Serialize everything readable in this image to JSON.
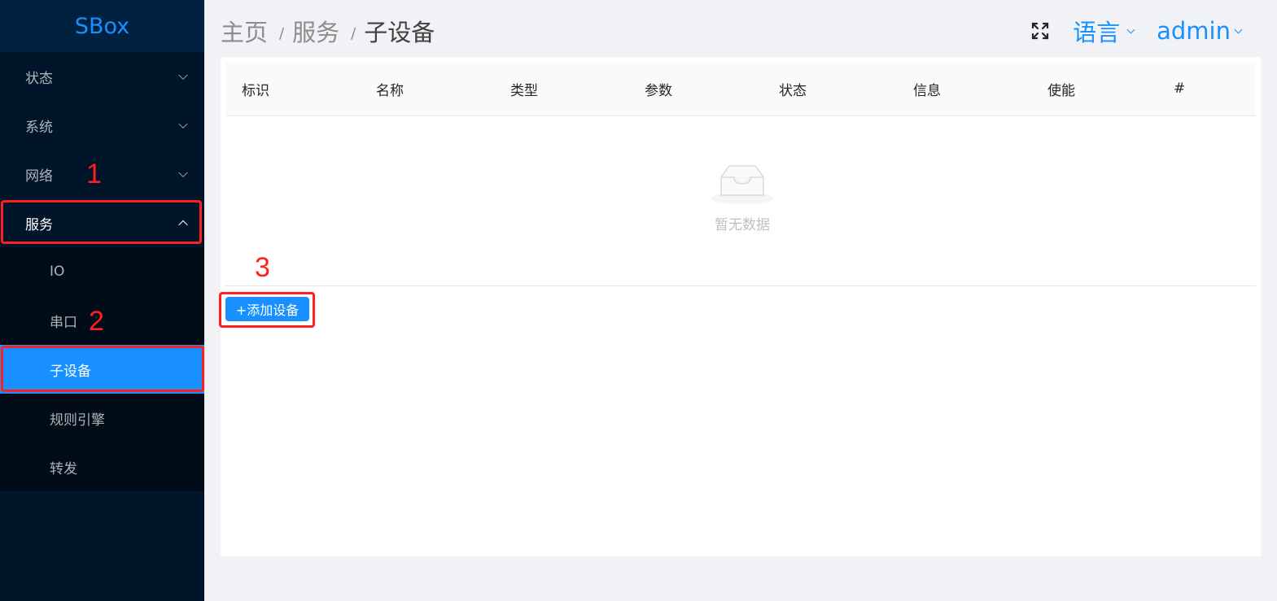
{
  "sidebar": {
    "logo": "SBox",
    "menu": [
      {
        "label": "状态"
      },
      {
        "label": "系统"
      },
      {
        "label": "网络"
      },
      {
        "label": "服务"
      }
    ],
    "submenu": [
      {
        "label": "IO"
      },
      {
        "label": "串口"
      },
      {
        "label": "子设备",
        "active": true
      },
      {
        "label": "规则引擎"
      },
      {
        "label": "转发"
      }
    ]
  },
  "header": {
    "breadcrumb": [
      "主页",
      "服务",
      "子设备"
    ],
    "separator": "/",
    "language": "语言",
    "user": "admin"
  },
  "table": {
    "columns": [
      "标识",
      "名称",
      "类型",
      "参数",
      "状态",
      "信息",
      "使能",
      "#"
    ],
    "empty_text": "暂无数据"
  },
  "actions": {
    "add_device": "+添加设备"
  },
  "annotations": {
    "step1": "1",
    "step2": "2",
    "step3": "3"
  },
  "colors": {
    "primary": "#1890ff",
    "sidebar_bg": "#001529",
    "annotation_red": "#ff1f1f"
  }
}
